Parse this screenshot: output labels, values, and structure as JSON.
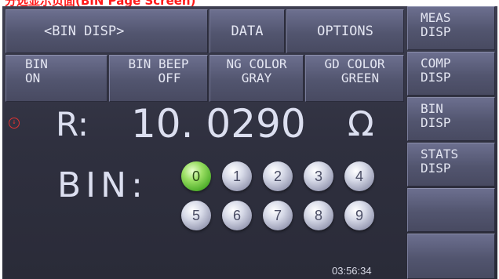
{
  "caption": "分选显示页面(BIN Page Screen)",
  "topbar": {
    "title": "<BIN DISP>",
    "data_label": "DATA",
    "options_label": "OPTIONS"
  },
  "settings": [
    {
      "line1": "BIN",
      "line2": "ON"
    },
    {
      "line1": "BIN BEEP",
      "line2": "OFF"
    },
    {
      "line1": "NG COLOR",
      "line2": "GRAY"
    },
    {
      "line1": "GD COLOR",
      "line2": "GREEN"
    }
  ],
  "sidebar": [
    {
      "line1": "MEAS",
      "line2": "DISP"
    },
    {
      "line1": "COMP",
      "line2": "DISP"
    },
    {
      "line1": "BIN",
      "line2": "DISP"
    },
    {
      "line1": "STATS",
      "line2": "DISP"
    },
    {
      "line1": "",
      "line2": ""
    },
    {
      "line1": "",
      "line2": ""
    }
  ],
  "measurement": {
    "param": "R:",
    "value": "10. 0290",
    "unit": "Ω",
    "bin_label": "BIN:"
  },
  "bins": [
    "0",
    "1",
    "2",
    "3",
    "4",
    "5",
    "6",
    "7",
    "8",
    "9"
  ],
  "active_bin": "0",
  "status": {
    "time": "03:56:34"
  },
  "colors": {
    "good": "#5cc235",
    "ng": "#a3a6bd",
    "background": "#33344a"
  }
}
